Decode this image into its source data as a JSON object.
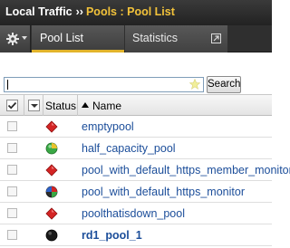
{
  "breadcrumb": {
    "section": "Local Traffic",
    "separator": "››",
    "current": "Pools : Pool List"
  },
  "tabs": [
    {
      "label": "Pool List",
      "active": true
    },
    {
      "label": "Statistics",
      "active": false
    }
  ],
  "filter": {
    "search_value": "",
    "search_button": "Search"
  },
  "table": {
    "headers": {
      "status": "Status",
      "name": "Name"
    },
    "rows": [
      {
        "name": "emptypool",
        "status": "red-diamond"
      },
      {
        "name": "half_capacity_pool",
        "status": "green-circle"
      },
      {
        "name": "pool_with_default_https_member_monitor",
        "status": "red-diamond"
      },
      {
        "name": "pool_with_default_https_monitor",
        "status": "multicolor-circle"
      },
      {
        "name": "poolthatisdown_pool",
        "status": "red-diamond"
      },
      {
        "name": "rd1_pool_1",
        "status": "black-circle"
      }
    ]
  },
  "colors": {
    "accent": "#e2b42b",
    "link": "#1c4e9a",
    "status_red": "#d42424",
    "status_green": "#39a845"
  }
}
